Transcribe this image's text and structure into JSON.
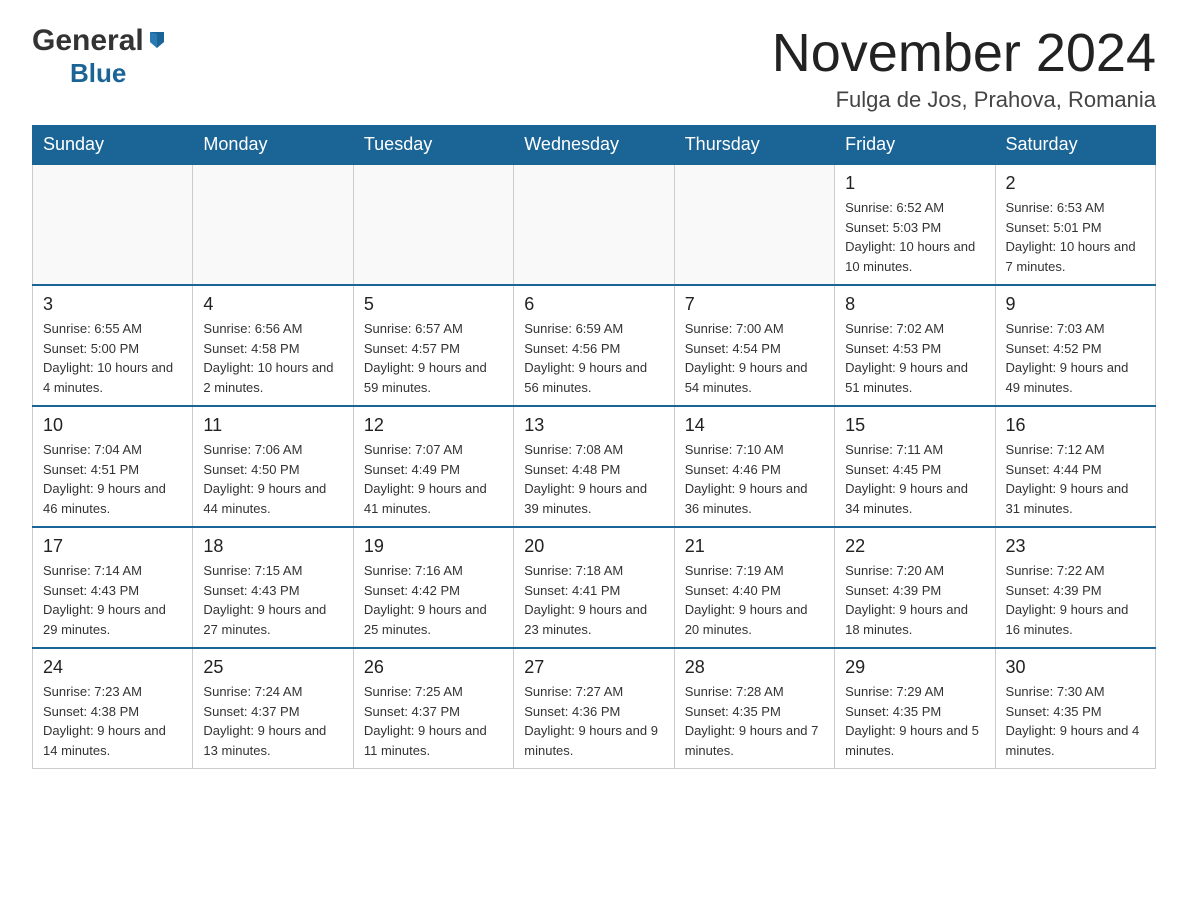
{
  "header": {
    "logo_general": "General",
    "logo_blue": "Blue",
    "title": "November 2024",
    "subtitle": "Fulga de Jos, Prahova, Romania"
  },
  "calendar": {
    "days_of_week": [
      "Sunday",
      "Monday",
      "Tuesday",
      "Wednesday",
      "Thursday",
      "Friday",
      "Saturday"
    ],
    "weeks": [
      [
        {
          "day": "",
          "info": ""
        },
        {
          "day": "",
          "info": ""
        },
        {
          "day": "",
          "info": ""
        },
        {
          "day": "",
          "info": ""
        },
        {
          "day": "",
          "info": ""
        },
        {
          "day": "1",
          "info": "Sunrise: 6:52 AM\nSunset: 5:03 PM\nDaylight: 10 hours and 10 minutes."
        },
        {
          "day": "2",
          "info": "Sunrise: 6:53 AM\nSunset: 5:01 PM\nDaylight: 10 hours and 7 minutes."
        }
      ],
      [
        {
          "day": "3",
          "info": "Sunrise: 6:55 AM\nSunset: 5:00 PM\nDaylight: 10 hours and 4 minutes."
        },
        {
          "day": "4",
          "info": "Sunrise: 6:56 AM\nSunset: 4:58 PM\nDaylight: 10 hours and 2 minutes."
        },
        {
          "day": "5",
          "info": "Sunrise: 6:57 AM\nSunset: 4:57 PM\nDaylight: 9 hours and 59 minutes."
        },
        {
          "day": "6",
          "info": "Sunrise: 6:59 AM\nSunset: 4:56 PM\nDaylight: 9 hours and 56 minutes."
        },
        {
          "day": "7",
          "info": "Sunrise: 7:00 AM\nSunset: 4:54 PM\nDaylight: 9 hours and 54 minutes."
        },
        {
          "day": "8",
          "info": "Sunrise: 7:02 AM\nSunset: 4:53 PM\nDaylight: 9 hours and 51 minutes."
        },
        {
          "day": "9",
          "info": "Sunrise: 7:03 AM\nSunset: 4:52 PM\nDaylight: 9 hours and 49 minutes."
        }
      ],
      [
        {
          "day": "10",
          "info": "Sunrise: 7:04 AM\nSunset: 4:51 PM\nDaylight: 9 hours and 46 minutes."
        },
        {
          "day": "11",
          "info": "Sunrise: 7:06 AM\nSunset: 4:50 PM\nDaylight: 9 hours and 44 minutes."
        },
        {
          "day": "12",
          "info": "Sunrise: 7:07 AM\nSunset: 4:49 PM\nDaylight: 9 hours and 41 minutes."
        },
        {
          "day": "13",
          "info": "Sunrise: 7:08 AM\nSunset: 4:48 PM\nDaylight: 9 hours and 39 minutes."
        },
        {
          "day": "14",
          "info": "Sunrise: 7:10 AM\nSunset: 4:46 PM\nDaylight: 9 hours and 36 minutes."
        },
        {
          "day": "15",
          "info": "Sunrise: 7:11 AM\nSunset: 4:45 PM\nDaylight: 9 hours and 34 minutes."
        },
        {
          "day": "16",
          "info": "Sunrise: 7:12 AM\nSunset: 4:44 PM\nDaylight: 9 hours and 31 minutes."
        }
      ],
      [
        {
          "day": "17",
          "info": "Sunrise: 7:14 AM\nSunset: 4:43 PM\nDaylight: 9 hours and 29 minutes."
        },
        {
          "day": "18",
          "info": "Sunrise: 7:15 AM\nSunset: 4:43 PM\nDaylight: 9 hours and 27 minutes."
        },
        {
          "day": "19",
          "info": "Sunrise: 7:16 AM\nSunset: 4:42 PM\nDaylight: 9 hours and 25 minutes."
        },
        {
          "day": "20",
          "info": "Sunrise: 7:18 AM\nSunset: 4:41 PM\nDaylight: 9 hours and 23 minutes."
        },
        {
          "day": "21",
          "info": "Sunrise: 7:19 AM\nSunset: 4:40 PM\nDaylight: 9 hours and 20 minutes."
        },
        {
          "day": "22",
          "info": "Sunrise: 7:20 AM\nSunset: 4:39 PM\nDaylight: 9 hours and 18 minutes."
        },
        {
          "day": "23",
          "info": "Sunrise: 7:22 AM\nSunset: 4:39 PM\nDaylight: 9 hours and 16 minutes."
        }
      ],
      [
        {
          "day": "24",
          "info": "Sunrise: 7:23 AM\nSunset: 4:38 PM\nDaylight: 9 hours and 14 minutes."
        },
        {
          "day": "25",
          "info": "Sunrise: 7:24 AM\nSunset: 4:37 PM\nDaylight: 9 hours and 13 minutes."
        },
        {
          "day": "26",
          "info": "Sunrise: 7:25 AM\nSunset: 4:37 PM\nDaylight: 9 hours and 11 minutes."
        },
        {
          "day": "27",
          "info": "Sunrise: 7:27 AM\nSunset: 4:36 PM\nDaylight: 9 hours and 9 minutes."
        },
        {
          "day": "28",
          "info": "Sunrise: 7:28 AM\nSunset: 4:35 PM\nDaylight: 9 hours and 7 minutes."
        },
        {
          "day": "29",
          "info": "Sunrise: 7:29 AM\nSunset: 4:35 PM\nDaylight: 9 hours and 5 minutes."
        },
        {
          "day": "30",
          "info": "Sunrise: 7:30 AM\nSunset: 4:35 PM\nDaylight: 9 hours and 4 minutes."
        }
      ]
    ]
  }
}
